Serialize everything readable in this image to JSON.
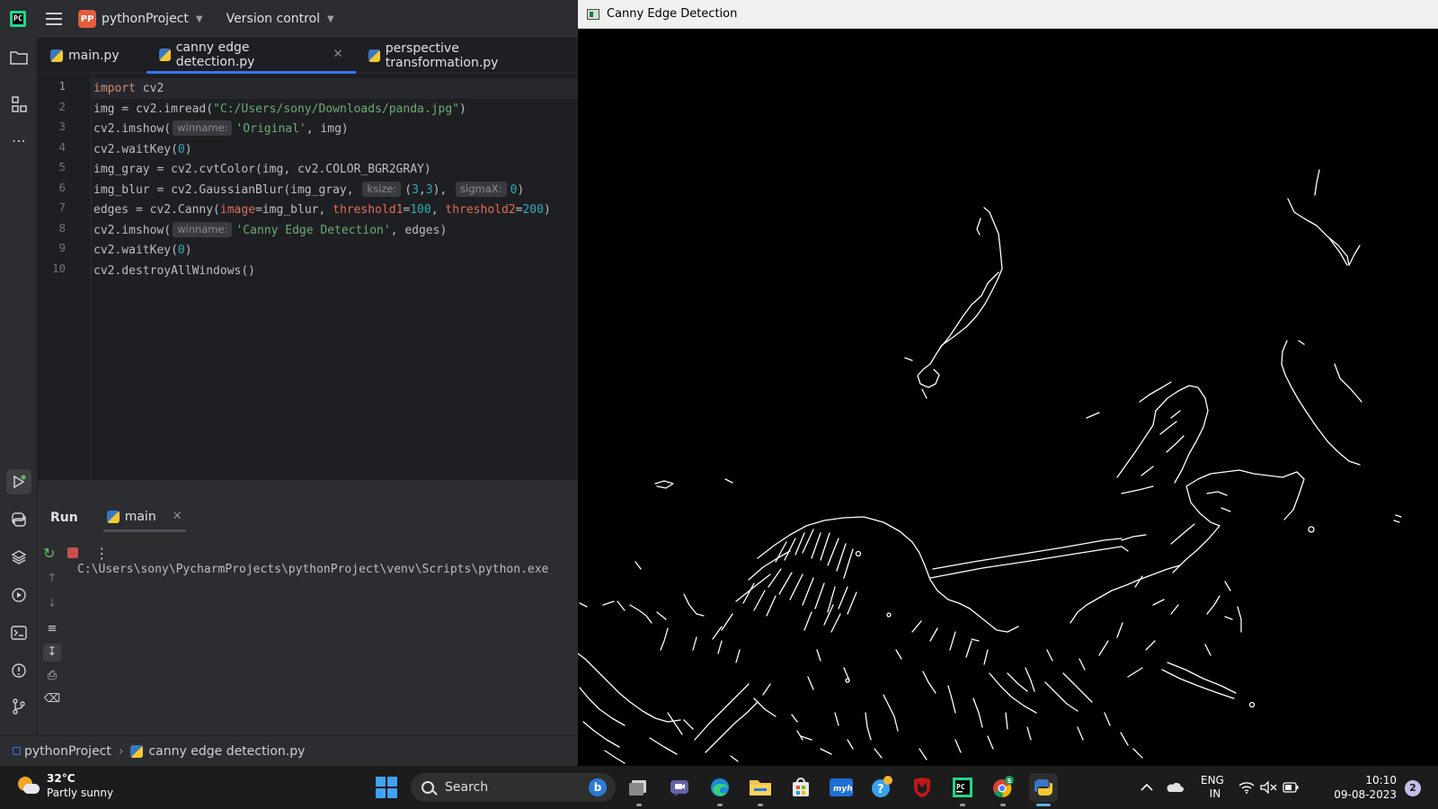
{
  "ide": {
    "project_badge": "PP",
    "project_name": "pythonProject",
    "version_control": "Version control",
    "tabs": [
      {
        "label": "main.py"
      },
      {
        "label": "canny edge detection.py"
      },
      {
        "label": "perspective transformation.py"
      }
    ],
    "line_numbers": [
      "1",
      "2",
      "3",
      "4",
      "5",
      "6",
      "7",
      "8",
      "9",
      "10"
    ],
    "code": {
      "l1_kw": "import",
      "l1_rest": " cv2",
      "l2_a": "img = cv2.imread(",
      "l2_str": "\"C:/Users/sony/Downloads/panda.jpg\"",
      "l2_b": ")",
      "l3_a": "cv2.imshow(",
      "l3_hint": "winname:",
      "l3_str": "'Original'",
      "l3_b": ", img)",
      "l4_a": "cv2.waitKey(",
      "l4_num": "0",
      "l4_b": ")",
      "l5": "img_gray = cv2.cvtColor(img, cv2.COLOR_BGR2GRAY)",
      "l6_a": "img_blur = cv2.GaussianBlur(img_gray, ",
      "l6_hint1": "ksize:",
      "l6_b": "(",
      "l6_n1": "3",
      "l6_c": ",",
      "l6_n2": "3",
      "l6_d": "), ",
      "l6_hint2": "sigmaX:",
      "l6_n3": "0",
      "l6_e": ")",
      "l7_a": "edges = cv2.Canny(",
      "l7_p1": "image",
      "l7_b": "=img_blur, ",
      "l7_p2": "threshold1",
      "l7_c": "=",
      "l7_n1": "100",
      "l7_d": ", ",
      "l7_p3": "threshold2",
      "l7_e": "=",
      "l7_n2": "200",
      "l7_f": ")",
      "l8_a": "cv2.imshow(",
      "l8_hint": "winname:",
      "l8_str": "'Canny Edge Detection'",
      "l8_b": ", edges)",
      "l9_a": "cv2.waitKey(",
      "l9_num": "0",
      "l9_b": ")",
      "l10": "cv2.destroyAllWindows()"
    },
    "run": {
      "title": "Run",
      "tab": "main",
      "console": "C:\\Users\\sony\\PycharmProjects\\pythonProject\\venv\\Scripts\\python.exe"
    },
    "statusbar": {
      "project": "pythonProject",
      "file": "canny edge detection.py"
    }
  },
  "cv_window": {
    "title": "Canny Edge Detection"
  },
  "taskbar": {
    "weather_temp": "32°C",
    "weather_desc": "Partly sunny",
    "search_label": "Search",
    "lang_1": "ENG",
    "lang_2": "IN",
    "time": "10:10",
    "date": "09-08-2023",
    "notifications": "2"
  },
  "colors": {
    "accent": "#3574f0",
    "editor_bg": "#1e1f22",
    "panel_bg": "#2b2d30"
  }
}
